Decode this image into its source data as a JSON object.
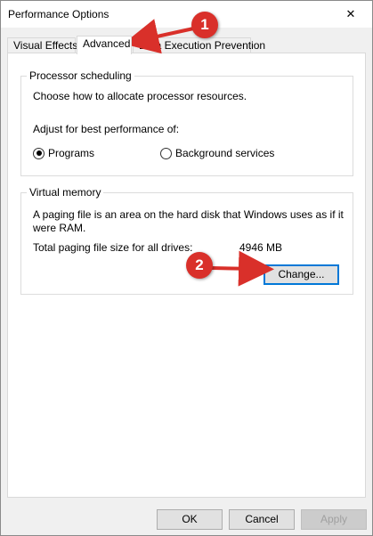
{
  "window": {
    "title": "Performance Options",
    "close_glyph": "✕"
  },
  "tabs": [
    {
      "label": "Visual Effects",
      "active": false
    },
    {
      "label": "Advanced",
      "active": true
    },
    {
      "label": "Data Execution Prevention",
      "active": false
    }
  ],
  "processor_scheduling": {
    "title": "Processor scheduling",
    "description": "Choose how to allocate processor resources.",
    "adjust_label": "Adjust for best performance of:",
    "options": [
      {
        "label": "Programs",
        "checked": true
      },
      {
        "label": "Background services",
        "checked": false
      }
    ]
  },
  "virtual_memory": {
    "title": "Virtual memory",
    "description_line1": "A paging file is an area on the hard disk that Windows uses as if it",
    "description_line2": "were RAM.",
    "total_label": "Total paging file size for all drives:",
    "total_value": "4946 MB",
    "change_button": "Change..."
  },
  "footer": {
    "ok_button": "OK",
    "cancel_button": "Cancel",
    "apply_button": "Apply"
  },
  "annotations": [
    {
      "number": "1",
      "color": "#d9302a"
    },
    {
      "number": "2",
      "color": "#d9302a"
    }
  ]
}
